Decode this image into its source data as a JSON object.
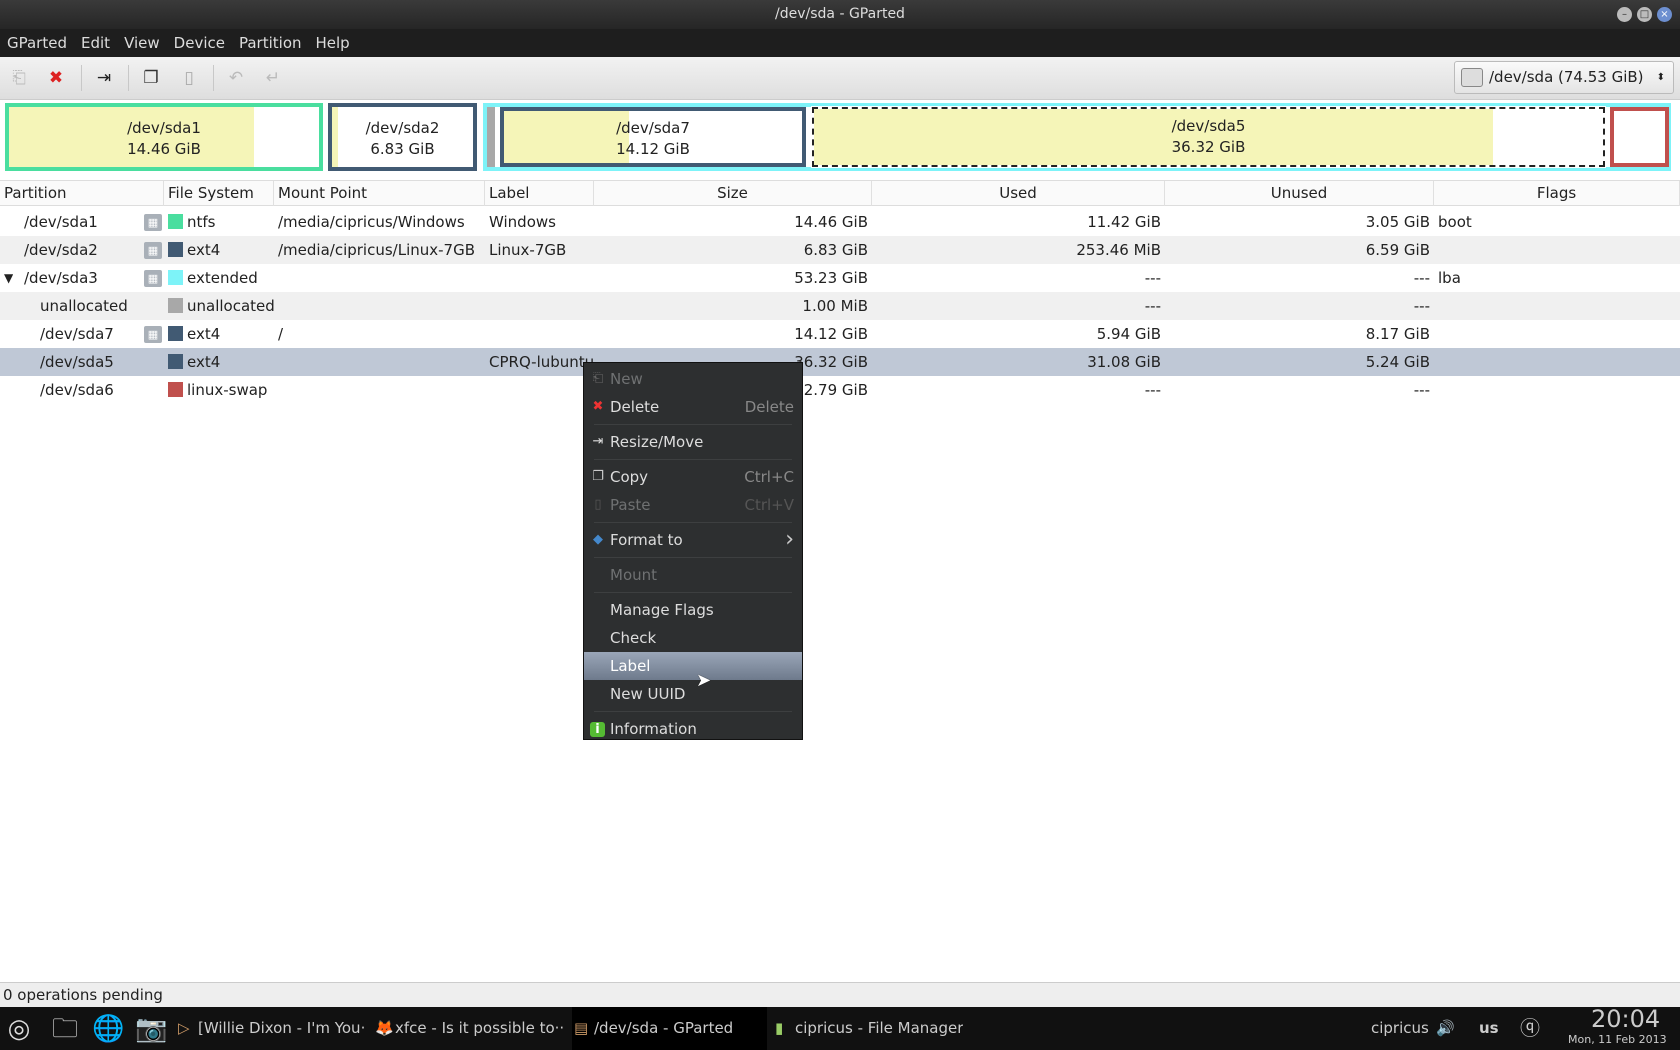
{
  "window": {
    "title": "/dev/sda - GParted"
  },
  "menubar": [
    {
      "label": "GParted"
    },
    {
      "label": "Edit"
    },
    {
      "label": "View"
    },
    {
      "label": "Device"
    },
    {
      "label": "Partition"
    },
    {
      "label": "Help"
    }
  ],
  "toolbar": {
    "icons": [
      "new-icon",
      "delete-icon",
      "resize-move-icon",
      "copy-icon",
      "paste-icon",
      "undo-icon",
      "apply-icon"
    ]
  },
  "device_selector": {
    "value": "/dev/sda  (74.53 GiB)"
  },
  "graph": [
    {
      "name": "/dev/sda1",
      "size": "14.46 GiB",
      "used_fraction": 0.79,
      "color": "#4ade9f"
    },
    {
      "name": "/dev/sda2",
      "size": "6.83 GiB",
      "used_fraction": 0.04,
      "color": "#415a73"
    },
    {
      "name": "/dev/sda7",
      "size": "14.12 GiB",
      "used_fraction": 0.42,
      "color": "#415a73"
    },
    {
      "name": "/dev/sda5",
      "size": "36.32 GiB",
      "used_fraction": 0.86,
      "color": "#415a73"
    }
  ],
  "colors": {
    "extended": "#7df3f8",
    "swap": "#c0504d",
    "unallocated": "#a8a8a8",
    "ext4": "#415a73",
    "ntfs": "#4ade9f"
  },
  "table": {
    "columns": [
      "Partition",
      "File System",
      "Mount Point",
      "Label",
      "Size",
      "Used",
      "Unused",
      "Flags"
    ],
    "rows": [
      {
        "partition": "/dev/sda1",
        "fs": "ntfs",
        "fs_color": "#4ade9f",
        "mount": "/media/cipricus/Windows",
        "label": "Windows",
        "size": "14.46 GiB",
        "used": "11.42 GiB",
        "unused": "3.05 GiB",
        "flags": "boot",
        "locked": true,
        "indent": 0
      },
      {
        "partition": "/dev/sda2",
        "fs": "ext4",
        "fs_color": "#415a73",
        "mount": "/media/cipricus/Linux-7GB",
        "label": "Linux-7GB",
        "size": "6.83 GiB",
        "used": "253.46 MiB",
        "unused": "6.59 GiB",
        "flags": "",
        "locked": true,
        "indent": 0
      },
      {
        "partition": "/dev/sda3",
        "fs": "extended",
        "fs_color": "#7df3f8",
        "mount": "",
        "label": "",
        "size": "53.23 GiB",
        "used": "---",
        "unused": "---",
        "flags": "lba",
        "locked": true,
        "indent": 0,
        "expander": "▼"
      },
      {
        "partition": "unallocated",
        "fs": "unallocated",
        "fs_color": "#a8a8a8",
        "mount": "",
        "label": "",
        "size": "1.00 MiB",
        "used": "---",
        "unused": "---",
        "flags": "",
        "locked": false,
        "indent": 1
      },
      {
        "partition": "/dev/sda7",
        "fs": "ext4",
        "fs_color": "#415a73",
        "mount": "/",
        "label": "",
        "size": "14.12 GiB",
        "used": "5.94 GiB",
        "unused": "8.17 GiB",
        "flags": "",
        "locked": true,
        "indent": 1
      },
      {
        "partition": "/dev/sda5",
        "fs": "ext4",
        "fs_color": "#415a73",
        "mount": "",
        "label": "CPRQ-lubuntu",
        "size": "36.32 GiB",
        "used": "31.08 GiB",
        "unused": "5.24 GiB",
        "flags": "",
        "locked": false,
        "indent": 1,
        "selected": true
      },
      {
        "partition": "/dev/sda6",
        "fs": "linux-swap",
        "fs_color": "#c0504d",
        "mount": "",
        "label": "",
        "size": "2.79 GiB",
        "used": "---",
        "unused": "---",
        "flags": "",
        "locked": false,
        "indent": 1
      }
    ]
  },
  "context_menu": [
    {
      "label": "New",
      "disabled": true,
      "icon": "new-icon"
    },
    {
      "label": "Delete",
      "accel": "Delete",
      "icon": "delete-icon"
    },
    {
      "sep": true
    },
    {
      "label": "Resize/Move",
      "icon": "resize-move-icon"
    },
    {
      "sep": true
    },
    {
      "label": "Copy",
      "accel": "Ctrl+C",
      "icon": "copy-icon"
    },
    {
      "label": "Paste",
      "accel": "Ctrl+V",
      "disabled": true,
      "icon": "paste-icon"
    },
    {
      "sep": true
    },
    {
      "label": "Format to",
      "submenu": true,
      "icon": "format-icon"
    },
    {
      "sep": true
    },
    {
      "label": "Mount",
      "disabled": true
    },
    {
      "sep": true
    },
    {
      "label": "Manage Flags"
    },
    {
      "label": "Check"
    },
    {
      "label": "Label",
      "highlighted": true
    },
    {
      "label": "New UUID"
    },
    {
      "sep": true
    },
    {
      "label": "Information",
      "icon": "information-icon"
    }
  ],
  "status": {
    "text": "0 operations pending"
  },
  "taskbar": {
    "tasks": [
      {
        "label": "[Willie Dixon - I'm You···"
      },
      {
        "label": "xfce - Is it possible to···"
      },
      {
        "label": "/dev/sda - GParted",
        "active": true
      },
      {
        "label": "cipricus - File Manager"
      }
    ],
    "user": "cipricus",
    "keyboard": "us",
    "time": "20:04",
    "date": "Mon, 11 Feb 2013"
  }
}
